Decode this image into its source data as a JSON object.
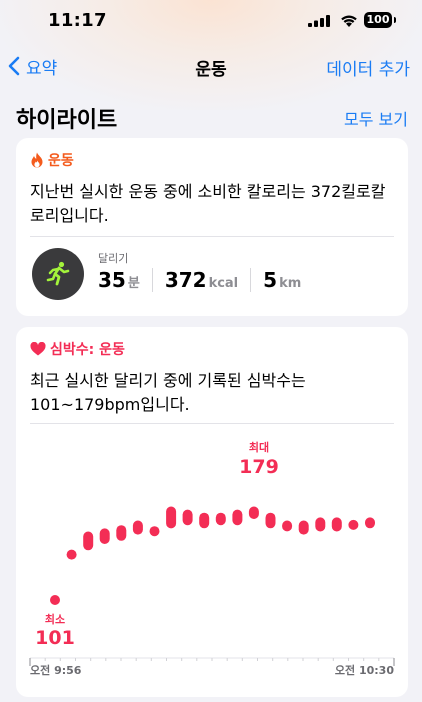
{
  "status": {
    "time": "11:17",
    "battery": "100"
  },
  "nav": {
    "back_label": "요약",
    "title": "운동",
    "action_label": "데이터 추가"
  },
  "highlights": {
    "title": "하이라이트",
    "show_all_label": "모두 보기"
  },
  "workout_card": {
    "category": "운동",
    "text": "지난번 실시한 운동 중에 소비한 칼로리는 372킬로칼로리입니다.",
    "activity": "달리기",
    "metrics": [
      {
        "value": "35",
        "unit": "분"
      },
      {
        "value": "372",
        "unit": "kcal"
      },
      {
        "value": "5",
        "unit": "km"
      }
    ]
  },
  "heart_card": {
    "category": "심박수: 운동",
    "text": "최근 실시한 달리기 중에 기록된 심박수는 101~179bpm입니다.",
    "max_label": "최대",
    "max_value": "179",
    "min_label": "최소",
    "min_value": "101",
    "x_start": "오전 9:56",
    "x_end": "오전 10:30"
  },
  "colors": {
    "accent": "#1a7cf4",
    "heart": "#f32d55",
    "workout": "#f45b1d"
  },
  "chart_data": {
    "type": "range-bar",
    "y_range_bpm": [
      101,
      179
    ],
    "ranges": [
      [
        101,
        106
      ],
      [
        130,
        136
      ],
      [
        136,
        148
      ],
      [
        140,
        150
      ],
      [
        142,
        152
      ],
      [
        146,
        155
      ],
      [
        145,
        150
      ],
      [
        150,
        164
      ],
      [
        152,
        162
      ],
      [
        150,
        160
      ],
      [
        152,
        160
      ],
      [
        152,
        162
      ],
      [
        156,
        164
      ],
      [
        150,
        160
      ],
      [
        148,
        155
      ],
      [
        146,
        155
      ],
      [
        148,
        157
      ],
      [
        148,
        157
      ],
      [
        149,
        155
      ],
      [
        150,
        157
      ]
    ],
    "min_index": 0,
    "max_index": 13
  }
}
